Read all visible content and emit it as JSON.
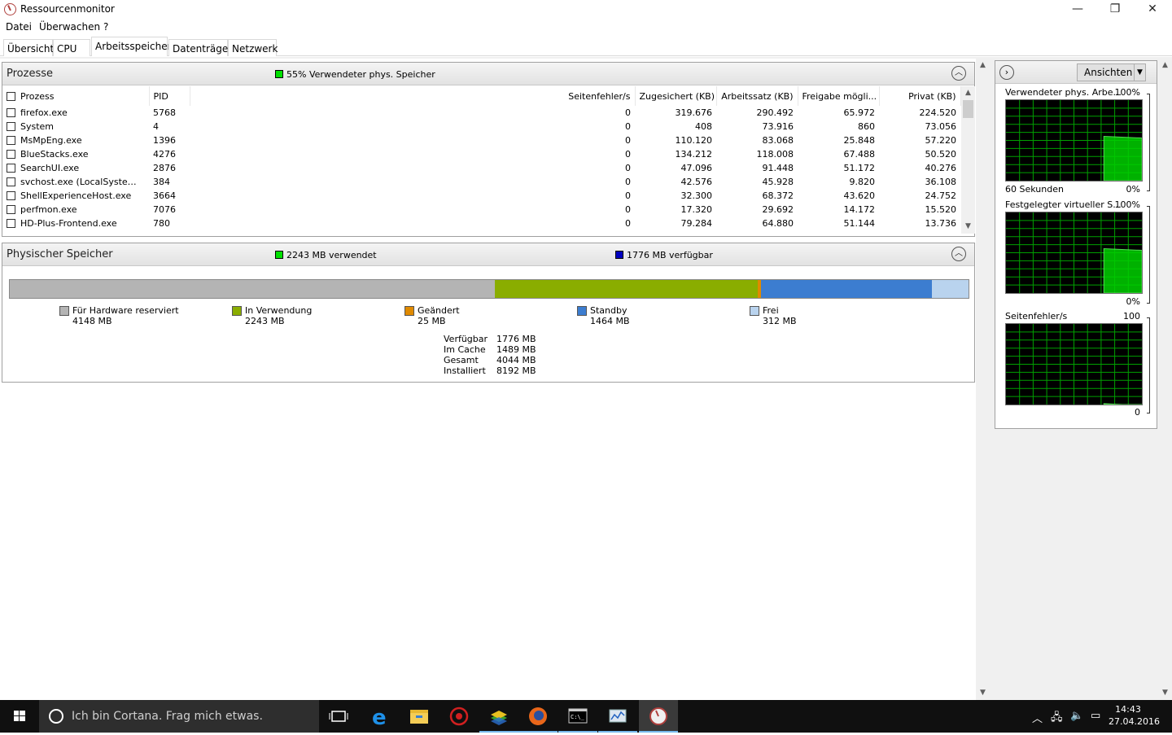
{
  "window": {
    "title": "Ressourcenmonitor",
    "minimize": "—",
    "restore": "❐",
    "close": "✕"
  },
  "menu": [
    "Datei",
    "Überwachen",
    "?"
  ],
  "tabs": [
    "Übersicht",
    "CPU",
    "Arbeitsspeicher",
    "Datenträger",
    "Netzwerk"
  ],
  "active_tab": "Arbeitsspeicher",
  "processes": {
    "title": "Prozesse",
    "status": "55% Verwendeter phys. Speicher",
    "status_color": "#00e000",
    "columns": [
      "Prozess",
      "PID",
      "Seitenfehler/s",
      "Zugesichert (KB)",
      "Arbeitssatz (KB)",
      "Freigabe mögli...",
      "Privat (KB)"
    ],
    "rows": [
      [
        "firefox.exe",
        "5768",
        "0",
        "319.676",
        "290.492",
        "65.972",
        "224.520"
      ],
      [
        "System",
        "4",
        "0",
        "408",
        "73.916",
        "860",
        "73.056"
      ],
      [
        "MsMpEng.exe",
        "1396",
        "0",
        "110.120",
        "83.068",
        "25.848",
        "57.220"
      ],
      [
        "BlueStacks.exe",
        "4276",
        "0",
        "134.212",
        "118.008",
        "67.488",
        "50.520"
      ],
      [
        "SearchUI.exe",
        "2876",
        "0",
        "47.096",
        "91.448",
        "51.172",
        "40.276"
      ],
      [
        "svchost.exe (LocalSystemNet...",
        "384",
        "0",
        "42.576",
        "45.928",
        "9.820",
        "36.108"
      ],
      [
        "ShellExperienceHost.exe",
        "3664",
        "0",
        "32.300",
        "68.372",
        "43.620",
        "24.752"
      ],
      [
        "perfmon.exe",
        "7076",
        "0",
        "17.320",
        "29.692",
        "14.172",
        "15.520"
      ],
      [
        "HD-Plus-Frontend.exe",
        "780",
        "0",
        "79.284",
        "64.880",
        "51.144",
        "13.736"
      ]
    ]
  },
  "physical": {
    "title": "Physischer Speicher",
    "used": "2243 MB verwendet",
    "used_color": "#00e000",
    "available": "1776 MB verfügbar",
    "available_color": "#0000c0",
    "segments": [
      {
        "label": "Für Hardware reserviert",
        "value": "4148 MB",
        "mb": 4148,
        "color": "#b4b4b4"
      },
      {
        "label": "In Verwendung",
        "value": "2243 MB",
        "mb": 2243,
        "color": "#8aad00"
      },
      {
        "label": "Geändert",
        "value": "25 MB",
        "mb": 25,
        "color": "#e08a00"
      },
      {
        "label": "Standby",
        "value": "1464 MB",
        "mb": 1464,
        "color": "#3c7dd0"
      },
      {
        "label": "Frei",
        "value": "312 MB",
        "mb": 312,
        "color": "#b9d3ee"
      }
    ],
    "stats": [
      {
        "label": "Verfügbar",
        "value": "1776 MB"
      },
      {
        "label": "Im Cache",
        "value": "1489 MB"
      },
      {
        "label": "Gesamt",
        "value": "4044 MB"
      },
      {
        "label": "Installiert",
        "value": "8192 MB"
      }
    ]
  },
  "graphs": {
    "views_label": "Ansichten",
    "items": [
      {
        "title": "Verwendeter phys. Arbe...",
        "max": "100%",
        "min": "0%",
        "footer": "60 Sekunden",
        "level": 0.55
      },
      {
        "title": "Festgelegter virtueller S...",
        "max": "100%",
        "min": "0%",
        "footer": "",
        "level": 0.55
      },
      {
        "title": "Seitenfehler/s",
        "max": "100",
        "min": "0",
        "footer": "",
        "level": 0.01
      }
    ]
  },
  "taskbar": {
    "search_placeholder": "Ich bin Cortana. Frag mich etwas.",
    "time": "14:43",
    "date": "27.04.2016"
  }
}
